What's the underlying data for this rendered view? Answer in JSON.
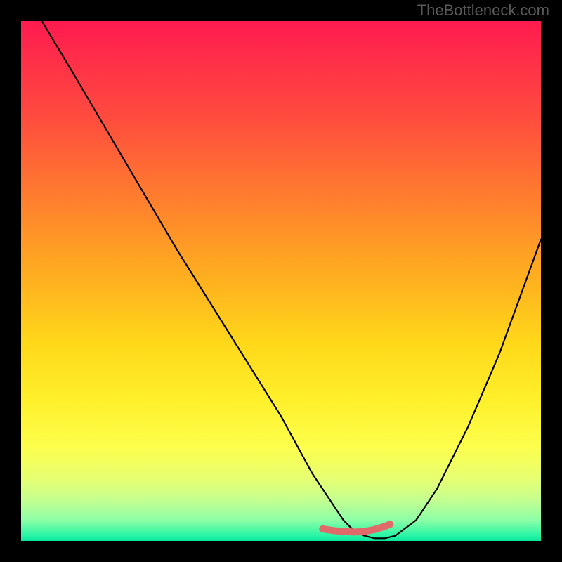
{
  "watermark": "TheBottleneck.com",
  "chart_data": {
    "type": "line",
    "title": "",
    "xlabel": "",
    "ylabel": "",
    "xlim": [
      0,
      100
    ],
    "ylim": [
      0,
      100
    ],
    "grid": false,
    "legend": false,
    "series": [
      {
        "name": "curve",
        "color": "#000000",
        "x": [
          4,
          10,
          20,
          30,
          40,
          50,
          56,
          58,
          60,
          62,
          64,
          66,
          68,
          70,
          72,
          76,
          80,
          86,
          92,
          100
        ],
        "y": [
          100,
          90,
          73,
          56,
          40,
          24,
          13,
          10,
          7,
          4,
          2,
          1,
          0.5,
          0.5,
          1,
          4,
          10,
          22,
          36,
          58
        ]
      },
      {
        "name": "optimal-zone",
        "color": "#e57373",
        "x": [
          58,
          60,
          62,
          64,
          66,
          68,
          70,
          71
        ],
        "y": [
          2.3,
          2.0,
          1.8,
          1.7,
          1.8,
          2.2,
          2.8,
          3.2
        ]
      }
    ],
    "background_gradient": {
      "stops": [
        {
          "pos": 0,
          "color": "#ff1a4f"
        },
        {
          "pos": 50,
          "color": "#ffb11f"
        },
        {
          "pos": 80,
          "color": "#fcff4d"
        },
        {
          "pos": 100,
          "color": "#08e59b"
        }
      ]
    }
  }
}
